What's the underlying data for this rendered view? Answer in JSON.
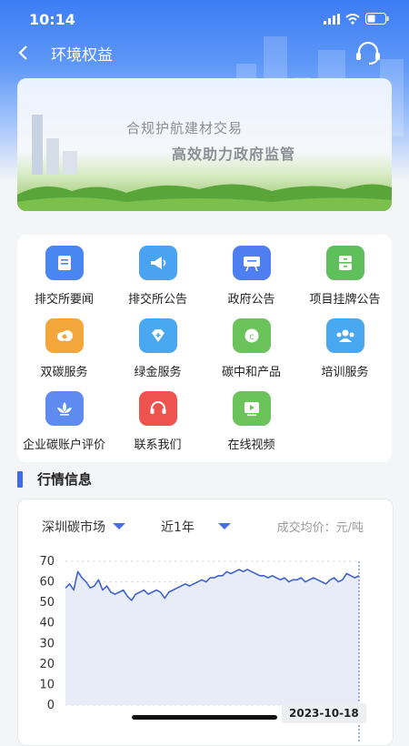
{
  "status": {
    "time": "10:14"
  },
  "nav": {
    "title": "环境权益"
  },
  "banner": {
    "line1": "合规护航建材交易",
    "line2": "高效助力政府监管"
  },
  "menu": {
    "items": [
      {
        "label": "排交所要闻",
        "icon": "news-icon",
        "color": "#4a86ef"
      },
      {
        "label": "排交所公告",
        "icon": "megaphone-icon",
        "color": "#4aa3f0"
      },
      {
        "label": "政府公告",
        "icon": "board-icon",
        "color": "#4f7ef0"
      },
      {
        "label": "项目挂牌公告",
        "icon": "cabinet-icon",
        "color": "#5fbf5a"
      },
      {
        "label": "双碳服务",
        "icon": "cloud-icon",
        "color": "#f3a73b"
      },
      {
        "label": "绿金服务",
        "icon": "diamond-icon",
        "color": "#4aa8f0"
      },
      {
        "label": "碳中和产品",
        "icon": "carbon-icon",
        "color": "#6cc25b"
      },
      {
        "label": "培训服务",
        "icon": "group-icon",
        "color": "#4aa8f0"
      },
      {
        "label": "企业碳账户评价",
        "icon": "lotus-icon",
        "color": "#5f8af0"
      },
      {
        "label": "联系我们",
        "icon": "headset-icon",
        "color": "#ef5350"
      },
      {
        "label": "在线视频",
        "icon": "video-icon",
        "color": "#6cc25b"
      }
    ]
  },
  "section": {
    "title": "行情信息"
  },
  "market": {
    "market_select": "深圳碳市场",
    "period_select": "近1年",
    "unit_label": "成交均价：元/吨",
    "date_label": "2023-10-18"
  },
  "chart_data": {
    "type": "area",
    "ylim": [
      0,
      70
    ],
    "yticks": [
      0,
      10,
      20,
      30,
      40,
      50,
      60,
      70
    ],
    "series": [
      {
        "values": [
          57,
          59,
          56,
          65,
          62,
          60,
          57,
          58,
          61,
          56,
          58,
          55,
          54,
          55,
          56,
          53,
          51,
          54,
          55,
          56,
          54,
          55,
          56,
          55,
          52,
          55,
          56,
          57,
          58,
          59,
          58,
          59,
          60,
          61,
          60,
          62,
          62,
          63,
          63,
          65,
          64,
          65,
          66,
          65,
          66,
          65,
          64,
          63,
          63,
          62,
          63,
          62,
          61,
          62,
          60,
          61,
          61,
          62,
          60,
          61,
          62,
          61,
          60,
          59,
          61,
          62,
          60,
          61,
          64,
          63,
          62,
          63
        ]
      }
    ],
    "line_color": "#3f63c8",
    "fill_color": "#e7ecf7",
    "last_label": "2023-10-18"
  }
}
